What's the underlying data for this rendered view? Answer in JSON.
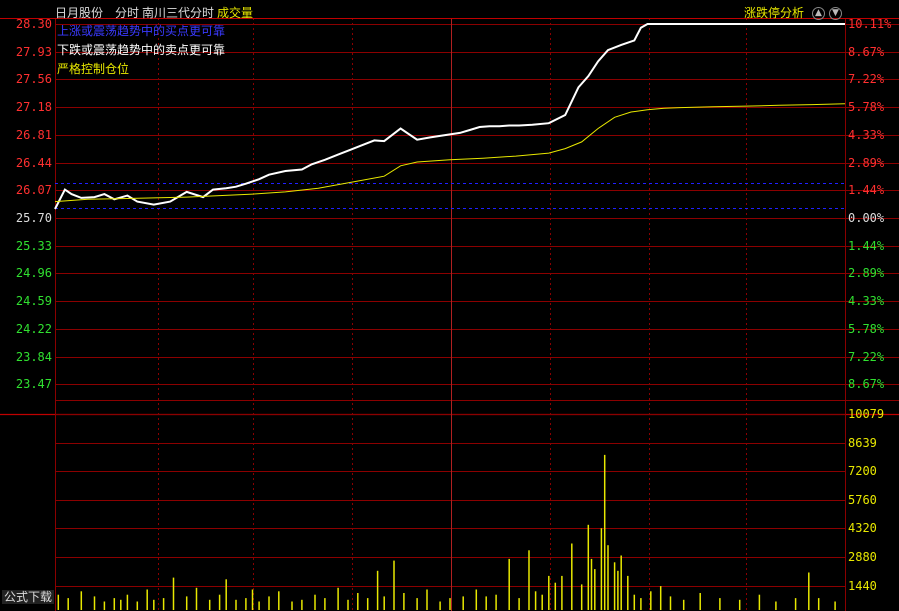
{
  "header": {
    "stock_name": "日月股份",
    "mode": "分时",
    "indicator": "南川三代分时",
    "volume_label": "成交量",
    "limit_label": "涨跌停分析"
  },
  "annotations": [
    {
      "text": "上涨或震荡趋势中的买点更可靠",
      "color": "#3a3aff"
    },
    {
      "text": "下跌或震荡趋势中的卖点更可靠",
      "color": "#ffffff"
    },
    {
      "text": "严格控制仓位",
      "color": "#e8e800"
    }
  ],
  "footer": {
    "formula_download": "公式下载"
  },
  "colors": {
    "up": "#ff3030",
    "down": "#30e030",
    "grid": "#8b0000",
    "price_line": "#ffffff",
    "avg_line": "#e8e800",
    "volume_bar": "#e8e800",
    "ref_line": "#2020ff"
  },
  "chart_data": [
    {
      "type": "line",
      "title": "",
      "left_ticks": [
        "28.30",
        "27.93",
        "27.56",
        "27.18",
        "26.81",
        "26.44",
        "26.07",
        "25.70",
        "25.33",
        "24.96",
        "24.59",
        "24.22",
        "23.84",
        "23.47"
      ],
      "right_ticks": [
        "10.11%",
        "8.67%",
        "7.22%",
        "5.78%",
        "4.33%",
        "2.89%",
        "1.44%",
        "0.00%",
        "1.44%",
        "2.89%",
        "4.33%",
        "5.78%",
        "7.22%",
        "8.67%"
      ],
      "ylim": [
        23.1,
        28.3
      ],
      "prev_close": 25.7,
      "x_range": [
        0,
        240
      ],
      "series": [
        {
          "key": "price",
          "x": [
            0,
            3,
            5,
            8,
            12,
            15,
            18,
            22,
            25,
            30,
            35,
            40,
            45,
            48,
            52,
            55,
            58,
            62,
            65,
            70,
            75,
            78,
            82,
            86,
            90,
            93,
            97,
            100,
            105,
            110,
            114,
            117,
            120,
            123,
            126,
            129,
            132,
            135,
            138,
            141,
            145,
            150,
            155,
            159,
            162,
            165,
            168,
            172,
            176,
            178,
            180,
            183,
            185,
            188,
            190,
            193,
            195,
            200,
            205,
            210,
            215,
            220,
            225,
            230,
            235,
            240
          ],
          "y": [
            25.82,
            26.08,
            26.02,
            25.97,
            25.98,
            26.02,
            25.95,
            26.0,
            25.92,
            25.88,
            25.92,
            26.05,
            25.98,
            26.08,
            26.1,
            26.12,
            26.16,
            26.22,
            26.28,
            26.33,
            26.35,
            26.42,
            26.48,
            26.55,
            26.62,
            26.67,
            26.74,
            26.73,
            26.9,
            26.75,
            26.78,
            26.8,
            26.82,
            26.84,
            26.88,
            26.92,
            26.93,
            26.93,
            26.94,
            26.94,
            26.95,
            26.97,
            27.08,
            27.45,
            27.6,
            27.8,
            27.95,
            28.02,
            28.08,
            28.25,
            28.3,
            28.3,
            28.3,
            28.3,
            28.3,
            28.3,
            28.3,
            28.3,
            28.3,
            28.3,
            28.3,
            28.3,
            28.3,
            28.3,
            28.3,
            28.3
          ]
        },
        {
          "key": "average",
          "x": [
            0,
            10,
            20,
            30,
            40,
            50,
            60,
            70,
            80,
            90,
            100,
            105,
            110,
            120,
            130,
            140,
            150,
            155,
            160,
            165,
            170,
            175,
            180,
            185,
            190,
            200,
            210,
            220,
            230,
            240
          ],
          "y": [
            25.92,
            25.95,
            25.96,
            25.97,
            25.98,
            26.0,
            26.02,
            26.05,
            26.1,
            26.18,
            26.26,
            26.4,
            26.45,
            26.48,
            26.5,
            26.53,
            26.57,
            26.63,
            26.72,
            26.9,
            27.05,
            27.12,
            27.15,
            27.17,
            27.18,
            27.19,
            27.2,
            27.21,
            27.22,
            27.23
          ]
        }
      ]
    },
    {
      "type": "bar",
      "title": "成交量",
      "ticks": [
        "10079",
        "8639",
        "7200",
        "5760",
        "4320",
        "2880",
        "1440"
      ],
      "ylim": [
        0,
        11500
      ],
      "x_range": [
        0,
        240
      ],
      "bar_x": [
        1,
        4,
        8,
        12,
        15,
        18,
        20,
        22,
        25,
        28,
        30,
        33,
        36,
        40,
        43,
        47,
        50,
        52,
        55,
        58,
        60,
        62,
        65,
        68,
        72,
        75,
        79,
        82,
        86,
        89,
        92,
        95,
        98,
        100,
        103,
        106,
        110,
        113,
        117,
        120,
        124,
        128,
        131,
        134,
        138,
        141,
        144,
        146,
        148,
        150,
        152,
        154,
        157,
        160,
        162,
        163,
        164,
        166,
        167,
        168,
        170,
        171,
        172,
        174,
        176,
        178,
        181,
        184,
        187,
        191,
        196,
        202,
        208,
        214,
        219,
        225,
        229,
        232,
        237
      ],
      "bar_values": [
        900,
        700,
        1100,
        800,
        500,
        700,
        600,
        900,
        500,
        1200,
        600,
        700,
        1900,
        800,
        1300,
        600,
        900,
        1800,
        600,
        700,
        1200,
        500,
        800,
        1100,
        500,
        600,
        900,
        700,
        1300,
        600,
        1000,
        700,
        2300,
        800,
        2900,
        1000,
        700,
        1200,
        500,
        700,
        800,
        1200,
        800,
        900,
        3000,
        700,
        3500,
        1100,
        900,
        2000,
        1600,
        2000,
        3900,
        1500,
        5000,
        3000,
        2400,
        4800,
        9100,
        3800,
        2800,
        2300,
        3200,
        2000,
        900,
        700,
        1100,
        1400,
        800,
        600,
        1000,
        700,
        600,
        900,
        500,
        700,
        2200,
        700,
        500
      ]
    }
  ]
}
